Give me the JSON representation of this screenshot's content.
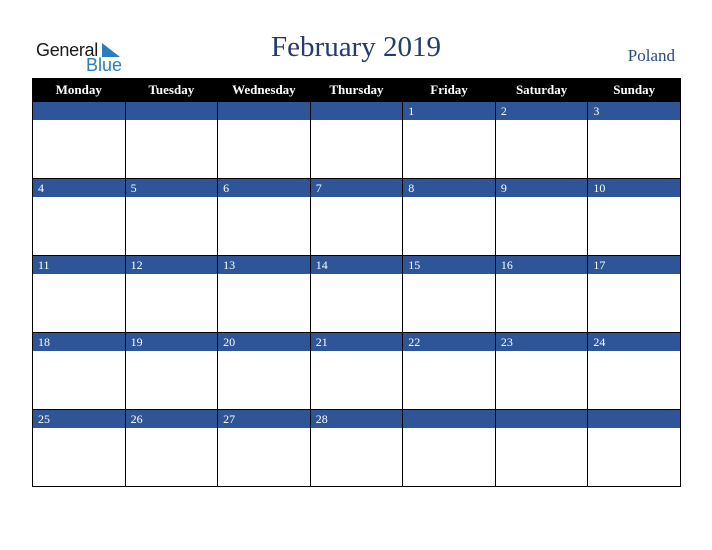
{
  "logo": {
    "general": "General",
    "blue": "Blue"
  },
  "title": "February 2019",
  "country": "Poland",
  "colors": {
    "header_bg": "#000000",
    "band": "#2d5597",
    "title": "#233c6b",
    "logo_blue": "#2a7dc0"
  },
  "weekdays": [
    "Monday",
    "Tuesday",
    "Wednesday",
    "Thursday",
    "Friday",
    "Saturday",
    "Sunday"
  ],
  "weeks": [
    [
      "",
      "",
      "",
      "",
      "1",
      "2",
      "3"
    ],
    [
      "4",
      "5",
      "6",
      "7",
      "8",
      "9",
      "10"
    ],
    [
      "11",
      "12",
      "13",
      "14",
      "15",
      "16",
      "17"
    ],
    [
      "18",
      "19",
      "20",
      "21",
      "22",
      "23",
      "24"
    ],
    [
      "25",
      "26",
      "27",
      "28",
      "",
      "",
      ""
    ]
  ]
}
